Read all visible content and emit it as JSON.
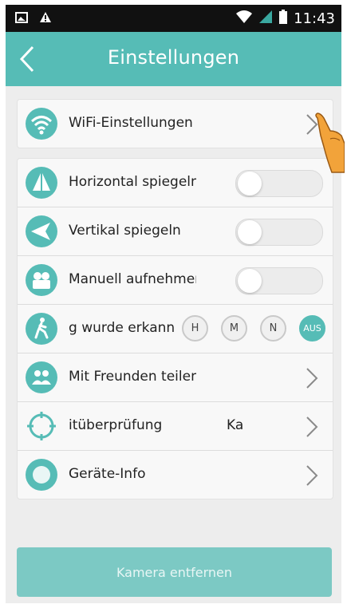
{
  "status_bar": {
    "time": "11:43",
    "icons": [
      "image-icon",
      "warning-icon",
      "wifi-icon",
      "signal-icon",
      "battery-icon"
    ]
  },
  "header": {
    "title": "Einstellungen",
    "back_icon": "back-arrow-icon"
  },
  "settings": {
    "wifi": {
      "label": "WiFi-Einstellungen",
      "icon": "wifi-icon"
    },
    "items": [
      {
        "label": "Horizontal spiegeln",
        "icon": "triangle-icon",
        "control": "toggle",
        "on": false
      },
      {
        "label": "Vertikal spiegeln",
        "icon": "paper-plane-icon",
        "control": "toggle",
        "on": false
      },
      {
        "label": "Manuell aufnehmen",
        "icon": "video-camera-icon",
        "control": "toggle",
        "on": false
      },
      {
        "label": "g wurde erkann",
        "icon": "walking-person-icon",
        "control": "modes",
        "modes": [
          "H",
          "M",
          "N",
          "AUS"
        ],
        "selected": "AUS"
      },
      {
        "label": "Mit Freunden teilen",
        "icon": "people-icon",
        "control": "chevron"
      },
      {
        "label": "itüberprüfung",
        "extra": "Ka",
        "icon": "crosshair-icon",
        "control": "chevron"
      },
      {
        "label": "Geräte-Info",
        "icon": "info-circle-icon",
        "control": "chevron"
      }
    ]
  },
  "remove_button": {
    "label": "Kamera entfernen"
  },
  "accent_color": "#56bcb6"
}
